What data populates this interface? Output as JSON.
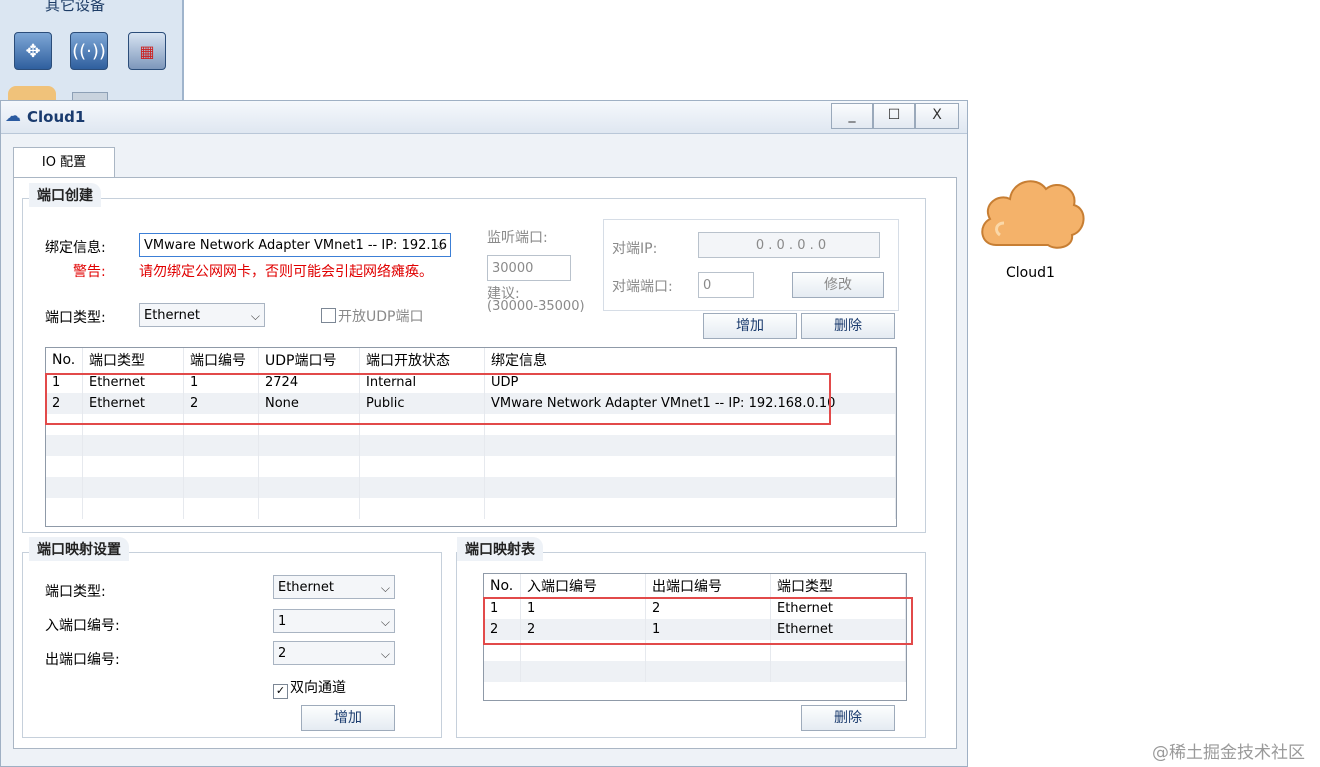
{
  "palette": {
    "title": "其它设备",
    "icons": [
      "router-icon",
      "wireless-ap-icon",
      "firewall-icon"
    ]
  },
  "dialog": {
    "title": "Cloud1",
    "minimize": "_",
    "maximize": "☐",
    "close": "X",
    "tab": "IO 配置"
  },
  "port_create": {
    "section_title": "端口创建",
    "binding_label": "绑定信息:",
    "binding_value": "VMware Network Adapter VMnet1 -- IP: 192.16",
    "warning_label": "警告:",
    "warning_text": "请勿绑定公网网卡，否则可能会引起网络瘫痪。",
    "port_type_label": "端口类型:",
    "port_type_value": "Ethernet",
    "udp_checkbox_label": "开放UDP端口",
    "listen_port_label": "监听端口:",
    "listen_port_value": "30000",
    "suggest_label": "建议:",
    "suggest_range": "(30000-35000)",
    "peer_ip_label": "对端IP:",
    "peer_ip_value": "0 . 0 . 0 . 0",
    "peer_port_label": "对端端口:",
    "peer_port_value": "0",
    "modify_button": "修改",
    "add_button": "增加",
    "delete_button": "删除",
    "table": {
      "headers": [
        "No.",
        "端口类型",
        "端口编号",
        "UDP端口号",
        "端口开放状态",
        "绑定信息"
      ],
      "rows": [
        [
          "1",
          "Ethernet",
          "1",
          "2724",
          "Internal",
          "UDP"
        ],
        [
          "2",
          "Ethernet",
          "2",
          "None",
          "Public",
          "VMware Network Adapter VMnet1 -- IP: 192.168.0.10"
        ]
      ]
    }
  },
  "port_mapping_settings": {
    "section_title": "端口映射设置",
    "port_type_label": "端口类型:",
    "port_type_value": "Ethernet",
    "in_port_label": "入端口编号:",
    "in_port_value": "1",
    "out_port_label": "出端口编号:",
    "out_port_value": "2",
    "bidirectional_label": "双向通道",
    "add_button": "增加"
  },
  "port_mapping_table": {
    "section_title": "端口映射表",
    "headers": [
      "No.",
      "入端口编号",
      "出端口编号",
      "端口类型"
    ],
    "rows": [
      [
        "1",
        "1",
        "2",
        "Ethernet"
      ],
      [
        "2",
        "2",
        "1",
        "Ethernet"
      ]
    ],
    "delete_button": "删除"
  },
  "canvas": {
    "device_label": "Cloud1"
  },
  "watermark": "@稀土掘金技术社区",
  "colors": {
    "highlight_box": "#e24a4a",
    "warning_text": "#e00000",
    "cloud_fill": "#f4b26a"
  }
}
